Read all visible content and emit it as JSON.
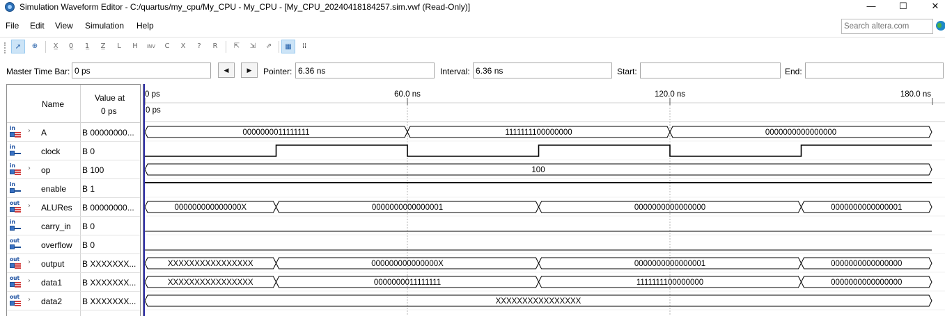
{
  "window": {
    "title": "Simulation Waveform Editor - C:/quartus/my_cpu/My_CPU - My_CPU - [My_CPU_20240418184257.sim.vwf (Read-Only)]",
    "controls": {
      "minimize": "—",
      "maximize": "☐",
      "close": "✕"
    }
  },
  "menu": {
    "items": [
      "File",
      "Edit",
      "View",
      "Simulation",
      "Help"
    ]
  },
  "search": {
    "placeholder": "Search altera.com"
  },
  "toolbar": {
    "icons": [
      "pointer-tool",
      "zoom-tool",
      "uninitialized-tool",
      "forcing-low-tool",
      "forcing-high-tool",
      "high-impedance-tool",
      "weak-low-tool",
      "weak-high-tool",
      "invert-tool",
      "count-value-tool",
      "clock-tool",
      "arbitrary-value-tool",
      "random-value-tool",
      "snap-to-grid-tool",
      "grid-tool",
      "find-tool",
      "replace-tool"
    ],
    "glyphs": [
      "➚",
      "⊕",
      "X̲",
      "0̲",
      "1̲",
      "Z̲",
      "L",
      "H",
      "INV",
      "C",
      "X",
      "?",
      "R",
      "⇱",
      "⇲",
      "⇗",
      "▦",
      "⁞⁞"
    ]
  },
  "timebar": {
    "master_label": "Master Time Bar:",
    "master_value": "0 ps",
    "pointer_label": "Pointer:",
    "pointer_value": "6.36 ns",
    "interval_label": "Interval:",
    "interval_value": "6.36 ns",
    "start_label": "Start:",
    "start_value": "",
    "end_label": "End:",
    "end_value": "",
    "prev_glyph": "◀",
    "next_glyph": "▶"
  },
  "node_header": {
    "name": "Name",
    "value_at": "Value at",
    "value_time": "0 ps"
  },
  "ruler": {
    "labels": [
      "0 ps",
      "60.0 ns",
      "120.0 ns",
      "180.0 ns"
    ],
    "cursor_label": "0 ps"
  },
  "signals": [
    {
      "name": "A",
      "direction": "in",
      "bus": true,
      "value": "B 00000000...",
      "segments": [
        {
          "t0": 0,
          "t1": 60,
          "label": "0000000011111111"
        },
        {
          "t0": 60,
          "t1": 120,
          "label": "1111111100000000"
        },
        {
          "t0": 120,
          "t1": 180,
          "label": "0000000000000000"
        }
      ]
    },
    {
      "name": "clock",
      "direction": "in",
      "bus": false,
      "value": "B 0",
      "levels": [
        {
          "t0": 0,
          "t1": 30,
          "v": 0
        },
        {
          "t0": 30,
          "t1": 60,
          "v": 1
        },
        {
          "t0": 60,
          "t1": 90,
          "v": 0
        },
        {
          "t0": 90,
          "t1": 120,
          "v": 1
        },
        {
          "t0": 120,
          "t1": 150,
          "v": 0
        },
        {
          "t0": 150,
          "t1": 180,
          "v": 1
        }
      ]
    },
    {
      "name": "op",
      "direction": "in",
      "bus": true,
      "value": "B 100",
      "segments": [
        {
          "t0": 0,
          "t1": 180,
          "label": "100"
        }
      ]
    },
    {
      "name": "enable",
      "direction": "in",
      "bus": false,
      "value": "B 1",
      "levels": [
        {
          "t0": 0,
          "t1": 180,
          "v": 1
        }
      ]
    },
    {
      "name": "ALURes",
      "direction": "out",
      "bus": true,
      "value": "B 00000000...",
      "segments": [
        {
          "t0": 0,
          "t1": 30,
          "label": "000000000000000X"
        },
        {
          "t0": 30,
          "t1": 90,
          "label": "0000000000000001"
        },
        {
          "t0": 90,
          "t1": 150,
          "label": "0000000000000000"
        },
        {
          "t0": 150,
          "t1": 180,
          "label": "0000000000000001"
        }
      ]
    },
    {
      "name": "carry_in",
      "direction": "in",
      "bus": false,
      "value": "B 0",
      "levels": [
        {
          "t0": 0,
          "t1": 180,
          "v": 0
        }
      ]
    },
    {
      "name": "overflow",
      "direction": "out",
      "bus": false,
      "value": "B 0",
      "levels": [
        {
          "t0": 0,
          "t1": 180,
          "v": 0
        }
      ]
    },
    {
      "name": "output",
      "direction": "out",
      "bus": true,
      "value": "B XXXXXXX...",
      "segments": [
        {
          "t0": 0,
          "t1": 30,
          "label": "XXXXXXXXXXXXXXXX"
        },
        {
          "t0": 30,
          "t1": 90,
          "label": "000000000000000X"
        },
        {
          "t0": 90,
          "t1": 150,
          "label": "0000000000000001"
        },
        {
          "t0": 150,
          "t1": 180,
          "label": "0000000000000000"
        }
      ]
    },
    {
      "name": "data1",
      "direction": "out",
      "bus": true,
      "value": "B XXXXXXX...",
      "segments": [
        {
          "t0": 0,
          "t1": 30,
          "label": "XXXXXXXXXXXXXXXX"
        },
        {
          "t0": 30,
          "t1": 90,
          "label": "0000000011111111"
        },
        {
          "t0": 90,
          "t1": 150,
          "label": "1111111100000000"
        },
        {
          "t0": 150,
          "t1": 180,
          "label": "0000000000000000"
        }
      ]
    },
    {
      "name": "data2",
      "direction": "out",
      "bus": true,
      "value": "B XXXXXXX...",
      "segments": [
        {
          "t0": 0,
          "t1": 180,
          "label": "XXXXXXXXXXXXXXXX"
        }
      ]
    }
  ],
  "colors": {
    "border": "#8e8e8e",
    "cursor_line": "#2a2aa8",
    "grid_line": "#b5b5b5",
    "pin_icon": "#3a72c4",
    "bus_mark": "#d23f3f",
    "toolbar_active": "#cce4f7"
  }
}
